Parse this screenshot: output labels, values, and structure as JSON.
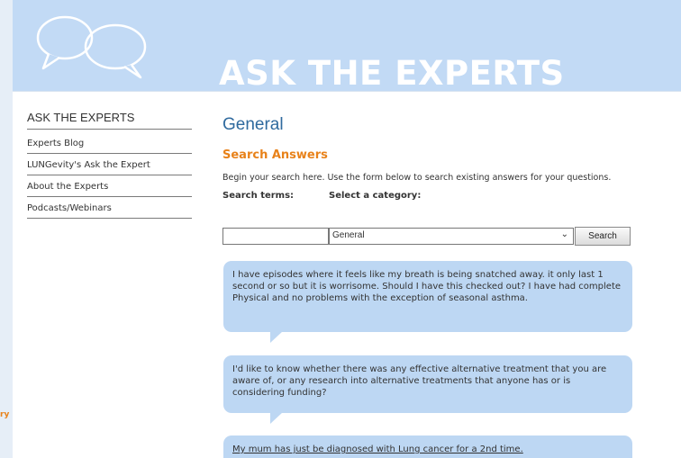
{
  "banner": {
    "title": "ASK THE EXPERTS",
    "logo_icon": "speech-bubbles-icon"
  },
  "brand_fragment": "ry",
  "sidebar": {
    "title": "ASK THE EXPERTS",
    "items": [
      {
        "label": "Experts Blog"
      },
      {
        "label": "LUNGevity's Ask the Expert"
      },
      {
        "label": "About the Experts"
      },
      {
        "label": "Podcasts/Webinars"
      }
    ]
  },
  "main": {
    "page_title": "General",
    "section_title": "Search Answers",
    "intro": "Begin your search here. Use the form below to search existing answers for your questions.",
    "search_terms_label": "Search terms:",
    "category_label": "Select a category:",
    "search_value": "",
    "category_value": "General",
    "search_button": "Search"
  },
  "questions": [
    {
      "text": "I have episodes where it feels like my breath is being snatched away. it only last 1 second or so but it is worrisome. Should I have this checked out? I have had complete Physical and no problems with the exception of seasonal asthma."
    },
    {
      "text": "I'd like to know whether there was any effective alternative treatment that you are aware of, or any research into alternative treatments that anyone has or is considering funding?"
    },
    {
      "text": "My mum has just be diagnosed with Lung cancer for a 2nd time."
    }
  ],
  "colors": {
    "banner": "#c2daf5",
    "bubble": "#bdd7f3",
    "accent": "#e8821a",
    "title": "#2f6a9e"
  }
}
